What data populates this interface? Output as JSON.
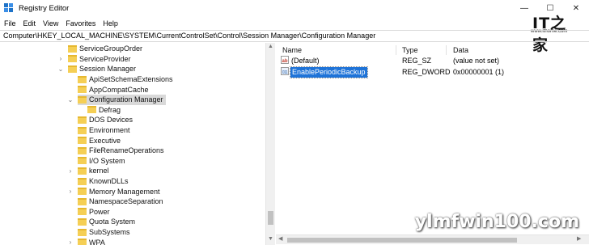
{
  "window": {
    "title": "Registry Editor",
    "controls": {
      "minimize": "—",
      "maximize": "☐",
      "close": "✕"
    }
  },
  "menu": [
    "File",
    "Edit",
    "View",
    "Favorites",
    "Help"
  ],
  "address": "Computer\\HKEY_LOCAL_MACHINE\\SYSTEM\\CurrentControlSet\\Control\\Session Manager\\Configuration Manager",
  "logo": {
    "big": "IT之家",
    "small": "www.ithome.com"
  },
  "tree": [
    {
      "label": "ServiceGroupOrder",
      "indent": 0,
      "expander": "",
      "selected": false
    },
    {
      "label": "ServiceProvider",
      "indent": 0,
      "expander": "›",
      "selected": false
    },
    {
      "label": "Session Manager",
      "indent": 0,
      "expander": "⌄",
      "selected": false
    },
    {
      "label": "ApiSetSchemaExtensions",
      "indent": 1,
      "expander": "",
      "selected": false
    },
    {
      "label": "AppCompatCache",
      "indent": 1,
      "expander": "",
      "selected": false
    },
    {
      "label": "Configuration Manager",
      "indent": 1,
      "expander": "⌄",
      "selected": true
    },
    {
      "label": "Defrag",
      "indent": 2,
      "expander": "",
      "selected": false
    },
    {
      "label": "DOS Devices",
      "indent": 1,
      "expander": "",
      "selected": false
    },
    {
      "label": "Environment",
      "indent": 1,
      "expander": "",
      "selected": false
    },
    {
      "label": "Executive",
      "indent": 1,
      "expander": "",
      "selected": false
    },
    {
      "label": "FileRenameOperations",
      "indent": 1,
      "expander": "",
      "selected": false
    },
    {
      "label": "I/O System",
      "indent": 1,
      "expander": "",
      "selected": false
    },
    {
      "label": "kernel",
      "indent": 1,
      "expander": "›",
      "selected": false
    },
    {
      "label": "KnownDLLs",
      "indent": 1,
      "expander": "",
      "selected": false
    },
    {
      "label": "Memory Management",
      "indent": 1,
      "expander": "›",
      "selected": false
    },
    {
      "label": "NamespaceSeparation",
      "indent": 1,
      "expander": "",
      "selected": false
    },
    {
      "label": "Power",
      "indent": 1,
      "expander": "",
      "selected": false
    },
    {
      "label": "Quota System",
      "indent": 1,
      "expander": "",
      "selected": false
    },
    {
      "label": "SubSystems",
      "indent": 1,
      "expander": "",
      "selected": false
    },
    {
      "label": "WPA",
      "indent": 1,
      "expander": "›",
      "selected": false
    }
  ],
  "list": {
    "columns": [
      "Name",
      "Type",
      "Data"
    ],
    "rows": [
      {
        "icon": "string-value-icon",
        "icon_text": "ab",
        "name": "(Default)",
        "type": "REG_SZ",
        "data": "(value not set)",
        "selected": false
      },
      {
        "icon": "binary-value-icon",
        "icon_text": "011",
        "name": "EnablePeriodicBackup",
        "type": "REG_DWORD",
        "data": "0x00000001 (1)",
        "selected": true
      }
    ]
  },
  "watermark": "ylmfwin100.com",
  "colors": {
    "folder": "#f5cf55",
    "selection": "#1e73d8",
    "tree_selection": "#d9d9d9"
  }
}
